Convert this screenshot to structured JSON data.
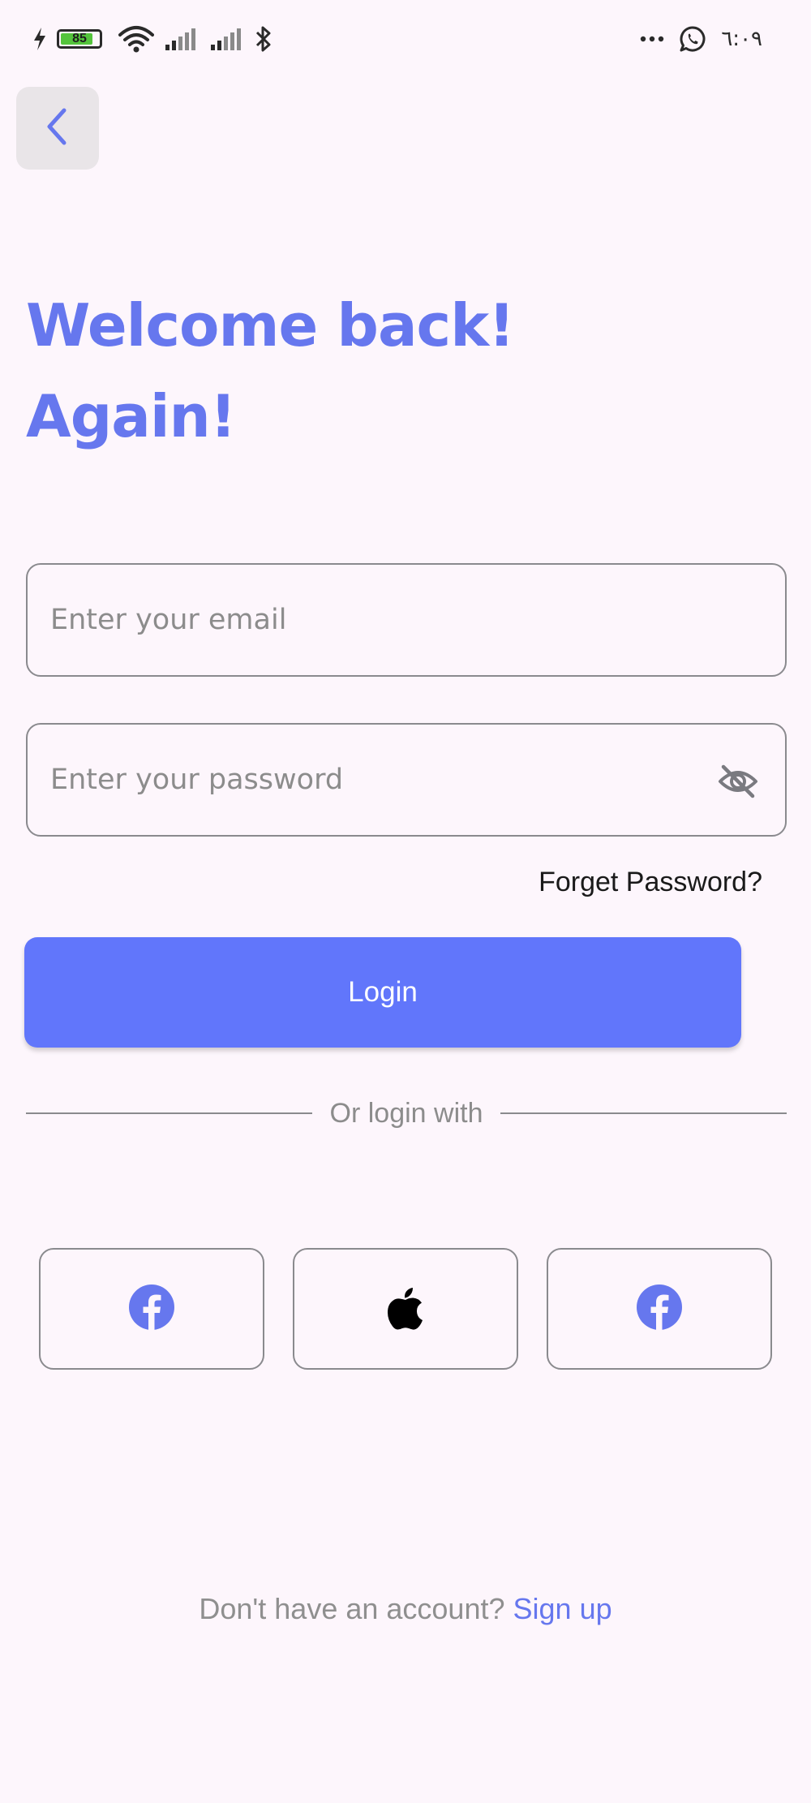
{
  "status_bar": {
    "battery_level": 85,
    "battery_label": "85",
    "time": "٦:٠٩",
    "icons": [
      "charging-bolt-icon",
      "battery-icon",
      "wifi-icon",
      "signal-icon",
      "signal-icon",
      "bluetooth-icon",
      "more-dots-icon",
      "whatsapp-icon"
    ]
  },
  "header": {
    "back_icon": "chevron-left-icon"
  },
  "headline": {
    "line1": "Welcome back!",
    "line2": "Again!"
  },
  "form": {
    "email_placeholder": "Enter your email",
    "password_placeholder": "Enter your password",
    "password_toggle_icon": "eye-off-icon",
    "forget_password": "Forget Password?",
    "login_label": "Login"
  },
  "divider": {
    "label": "Or login with"
  },
  "social": {
    "buttons": [
      {
        "icon": "facebook-icon"
      },
      {
        "icon": "apple-icon"
      },
      {
        "icon": "facebook-icon"
      }
    ]
  },
  "footer": {
    "prompt": "Don't have an account?",
    "signup_label": "Sign up"
  },
  "colors": {
    "background": "#fdf6fc",
    "accent": "#6677ee",
    "button": "#6176fb",
    "border": "#8a8a8e"
  }
}
